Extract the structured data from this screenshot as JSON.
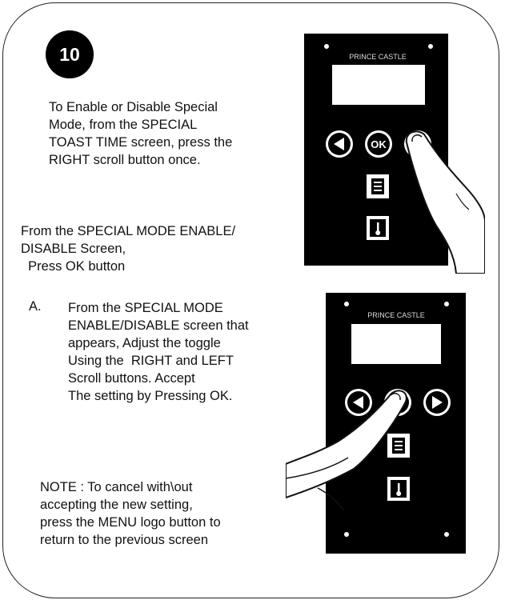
{
  "step": {
    "number": "10"
  },
  "instructions": {
    "enable_disable": "To Enable or Disable Special\nMode, from the SPECIAL\nTOAST TIME screen, press the\nRIGHT scroll button once.",
    "from_screen": "From the SPECIAL MODE ENABLE/\nDISABLE Screen,\n  Press OK button",
    "step_a_letter": "A.",
    "step_a": "From the SPECIAL MODE\nENABLE/DISABLE screen that\nappears, Adjust the toggle\nUsing the  RIGHT and LEFT\nScroll buttons. Accept\nThe setting by Pressing OK.",
    "note": "NOTE : To cancel with\\out\naccepting the new setting,\npress the MENU logo button to\nreturn to the previous screen"
  },
  "panels": {
    "brand": "PRINCE CASTLE",
    "ok_label": "OK"
  },
  "colors": {
    "panel": "#000000",
    "border": "#222222",
    "badge": "#000000"
  }
}
